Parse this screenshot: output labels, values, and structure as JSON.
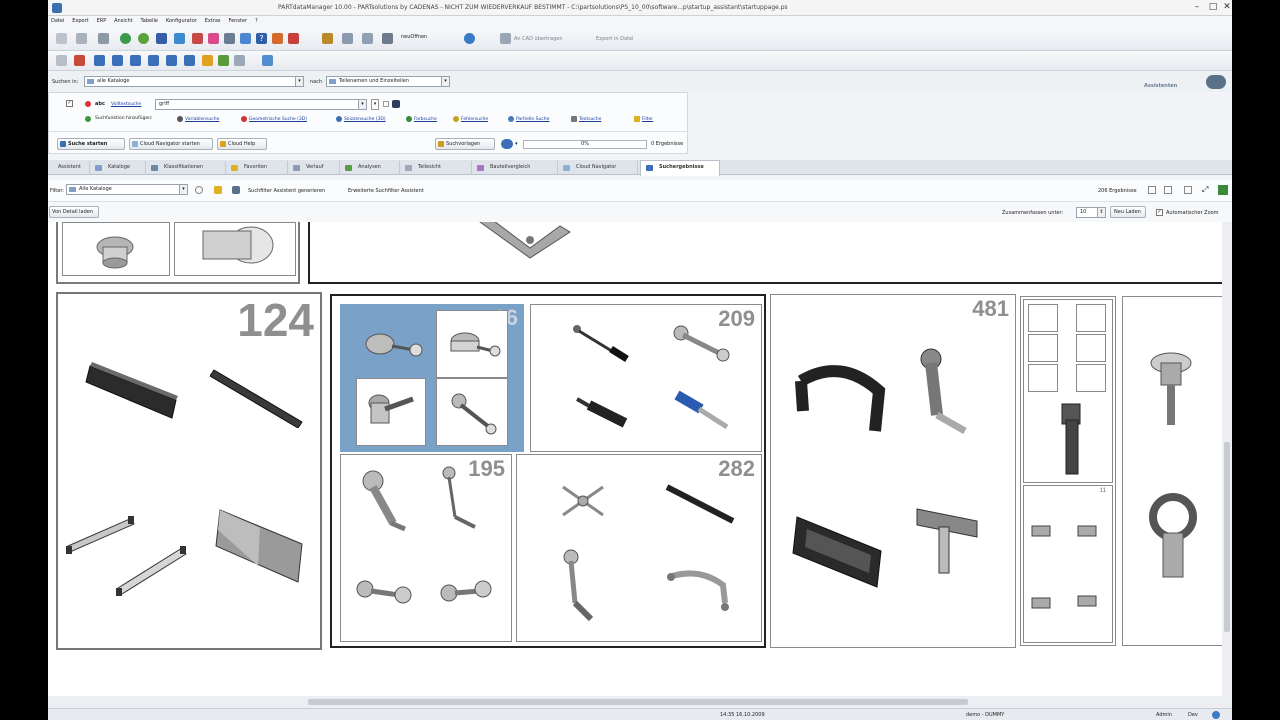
{
  "window": {
    "title": "PARTdataManager 10.00 - PARTsolutions by CADENAS - NICHT ZUM WIEDERVERKAUF BESTIMMT - C:\\partsolutions\\PS_10_00\\software...p\\startup_assistant\\startuppage.ps",
    "minimize": "–",
    "maximize": "□",
    "close": "✕"
  },
  "menu": [
    "Datei",
    "Export",
    "ERP",
    "Ansicht",
    "Tabelle",
    "Konfigurator",
    "Extras",
    "Fenster",
    "?"
  ],
  "toolbar1": {
    "view_combo": "neuOffnen",
    "cad_label": "An CAD übertragen",
    "export_label": "Export in Datei"
  },
  "searchbar": {
    "search_in_label": "Suchen in:",
    "catalog_value": "alle Kataloge",
    "after_label": "nach",
    "scope_value": "Teilenamen und Einzelteilen",
    "brand": "Assistenten"
  },
  "searchpanel": {
    "mode_label": "Volltextsuche",
    "query_value": "griff",
    "add_label": "Suchfunktion hinzufügen:",
    "methods": [
      "Variablensuche",
      "Geometrische Suche (3D)",
      "Skizzensuche (3D)",
      "Farbsuche",
      "Fehlersuche",
      "Partielle Suche",
      "Textsuche",
      "Filter"
    ],
    "start_search": "Suche starten",
    "cloud_start": "Cloud Navigator starten",
    "cloud_help": "Cloud Help",
    "suggest": "Suchvorlagen",
    "progress_text": "0%",
    "result_count": "0 Ergebnisse"
  },
  "tabs": [
    "Assistent",
    "Kataloge",
    "Klassifikationen",
    "Favoriten",
    "Verlauf",
    "Analysen",
    "Teilesicht",
    "Bauteilvergleich",
    "Cloud Navigator",
    "Suchergebnisse"
  ],
  "active_tab": "Suchergebnisse",
  "filterbar": {
    "filter_label": "Filter:",
    "filter_value": "Alle Kataloge",
    "wizard_text": "Suchfilter Assistent generieren",
    "extended_text": "Erweiterte Suchfilter Assistent",
    "results_text": "206 Ergebnisse"
  },
  "optbar": {
    "show_parts": "Von Detail laden",
    "merge_label": "Zusammenfassen unter:",
    "merge_value": "10",
    "reload": "Neu Laden",
    "autozoom": "Automatischer Zoom"
  },
  "clusters": [
    {
      "id": "c124",
      "count": "124"
    },
    {
      "id": "c16",
      "count": "16"
    },
    {
      "id": "c209",
      "count": "209"
    },
    {
      "id": "c195",
      "count": "195"
    },
    {
      "id": "c282",
      "count": "282"
    },
    {
      "id": "c481",
      "count": "481"
    },
    {
      "id": "cmix",
      "count": "11"
    }
  ],
  "statusbar": {
    "time": "14:35 16.10.2009",
    "user": "demo - DUMMY",
    "role": "Admin",
    "mode": "Dev"
  },
  "colors": {
    "selected_tile": "#7aa2c9",
    "count_text": "#8f8f8f",
    "tab_bar": "#dfe4ea"
  }
}
